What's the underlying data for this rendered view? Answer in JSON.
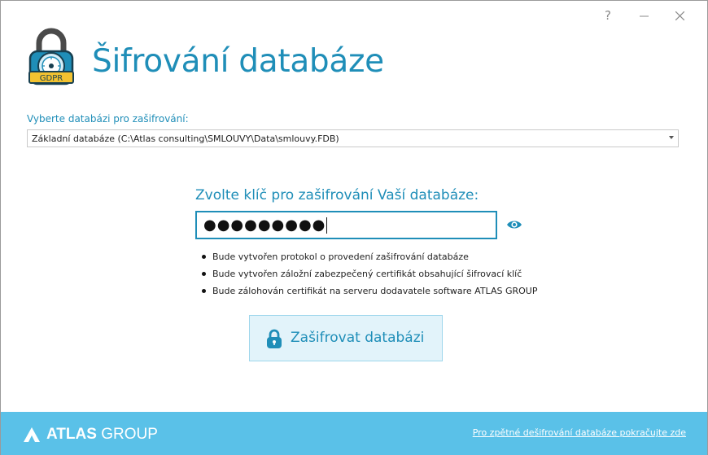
{
  "window_controls": {
    "help": "?",
    "minimize_icon": "minimize-icon",
    "close_icon": "close-icon"
  },
  "header": {
    "title": "Šifrování databáze",
    "logo_badge": "GDPR"
  },
  "database": {
    "label": "Vyberte databázi pro zašifrování:",
    "selected": "Základní databáze (C:\\Atlas consulting\\SMLOUVY\\Data\\smlouvy.FDB)"
  },
  "key": {
    "label": "Zvolte klíč pro zašifrování Vaší databáze:",
    "masked_value": "●●●●●●●●●"
  },
  "notes": [
    "Bude vytvořen protokol o provedení zašifrování databáze",
    "Bude vytvořen záložní zabezpečený certifikát obsahující šifrovací klíč",
    "Bude zálohován certifikát na serveru dodavatele software ATLAS GROUP"
  ],
  "encrypt_button": {
    "label": "Zašifrovat databázi"
  },
  "footer": {
    "brand_bold": "ATLAS",
    "brand_regular": "GROUP",
    "decrypt_link": "Pro zpětné dešifrování databáze pokračujte zde"
  },
  "colors": {
    "accent": "#1f8eb8",
    "footer_bg": "#5ac1e8",
    "button_bg": "#e2f3fa",
    "badge": "#f2c230"
  }
}
